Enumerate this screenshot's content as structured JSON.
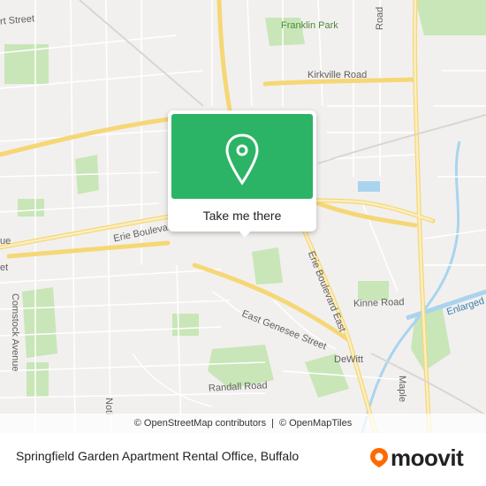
{
  "map": {
    "labels": {
      "street": "rt Street",
      "franklin_park": "Franklin Park",
      "kirkville": "Kirkville Road",
      "erie_blvd": "Erie Boulevard",
      "erie_blvd_east": "Erie Boulevard East",
      "ue": "ue",
      "et": "et",
      "comstock": "Comstock Avenue",
      "east_genesee": "East Genesee Street",
      "kinne": "Kinne Road",
      "enlarged": "Enlarged",
      "dewitt": "DeWitt",
      "randall": "Randall Road",
      "maple": "Maple",
      "noti": "Noti",
      "road_top_right": "Road"
    },
    "colors": {
      "background": "#f2f0ee",
      "park": "#c8e6b8",
      "water": "#a9d4ef",
      "road_major": "#f8e6a0",
      "road_minor": "#ffffff",
      "popup_green": "#2cb466"
    }
  },
  "popup": {
    "button_label": "Take me there",
    "icon": "location-pin-icon"
  },
  "attribution": {
    "osm": "© OpenStreetMap contributors",
    "sep": "|",
    "omt": "© OpenMapTiles"
  },
  "footer": {
    "title": "Springfield Garden Apartment Rental Office, Buffalo",
    "brand": "moovit",
    "brand_color": "#ff6a00"
  }
}
